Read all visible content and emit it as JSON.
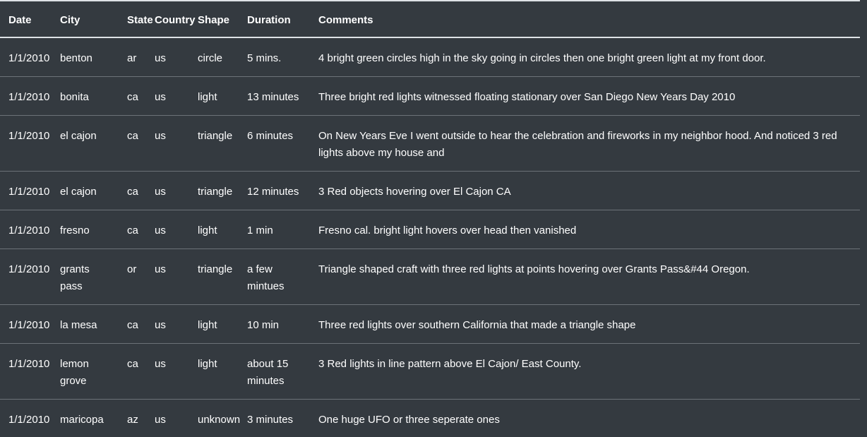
{
  "table": {
    "headers": [
      "Date",
      "City",
      "State",
      "Country",
      "Shape",
      "Duration",
      "Comments"
    ],
    "rows": [
      [
        "1/1/2010",
        "benton",
        "ar",
        "us",
        "circle",
        "5 mins.",
        "4 bright green circles high in the sky going in circles then one bright green light at my front door."
      ],
      [
        "1/1/2010",
        "bonita",
        "ca",
        "us",
        "light",
        "13 minutes",
        "Three bright red lights witnessed floating stationary over San Diego New Years Day 2010"
      ],
      [
        "1/1/2010",
        "el cajon",
        "ca",
        "us",
        "triangle",
        "6 minutes",
        "On New Years Eve I went outside to hear the celebration and fireworks in my neighbor hood. And noticed 3 red lights above my house and"
      ],
      [
        "1/1/2010",
        "el cajon",
        "ca",
        "us",
        "triangle",
        "12 minutes",
        "3 Red objects hovering over El Cajon CA"
      ],
      [
        "1/1/2010",
        "fresno",
        "ca",
        "us",
        "light",
        "1 min",
        "Fresno cal. bright light hovers over head then vanished"
      ],
      [
        "1/1/2010",
        "grants pass",
        "or",
        "us",
        "triangle",
        "a few mintues",
        "Triangle shaped craft with three red lights at points hovering over Grants Pass&#44 Oregon."
      ],
      [
        "1/1/2010",
        "la mesa",
        "ca",
        "us",
        "light",
        "10 min",
        "Three red lights over southern California that made a triangle shape"
      ],
      [
        "1/1/2010",
        "lemon grove",
        "ca",
        "us",
        "light",
        "about 15 minutes",
        "3 Red lights in line pattern above El Cajon/ East County."
      ],
      [
        "1/1/2010",
        "maricopa",
        "az",
        "us",
        "unknown",
        "3 minutes",
        "One huge UFO or three seperate ones"
      ]
    ]
  }
}
